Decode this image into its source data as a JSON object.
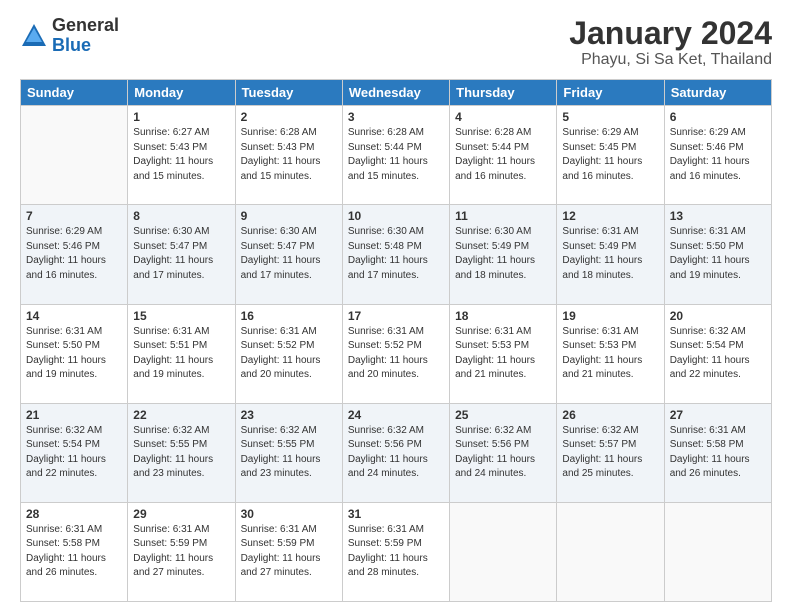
{
  "logo": {
    "general": "General",
    "blue": "Blue"
  },
  "title": "January 2024",
  "subtitle": "Phayu, Si Sa Ket, Thailand",
  "days_of_week": [
    "Sunday",
    "Monday",
    "Tuesday",
    "Wednesday",
    "Thursday",
    "Friday",
    "Saturday"
  ],
  "weeks": [
    [
      {
        "num": "",
        "sunrise": "",
        "sunset": "",
        "daylight": ""
      },
      {
        "num": "1",
        "sunrise": "Sunrise: 6:27 AM",
        "sunset": "Sunset: 5:43 PM",
        "daylight": "Daylight: 11 hours and 15 minutes."
      },
      {
        "num": "2",
        "sunrise": "Sunrise: 6:28 AM",
        "sunset": "Sunset: 5:43 PM",
        "daylight": "Daylight: 11 hours and 15 minutes."
      },
      {
        "num": "3",
        "sunrise": "Sunrise: 6:28 AM",
        "sunset": "Sunset: 5:44 PM",
        "daylight": "Daylight: 11 hours and 15 minutes."
      },
      {
        "num": "4",
        "sunrise": "Sunrise: 6:28 AM",
        "sunset": "Sunset: 5:44 PM",
        "daylight": "Daylight: 11 hours and 16 minutes."
      },
      {
        "num": "5",
        "sunrise": "Sunrise: 6:29 AM",
        "sunset": "Sunset: 5:45 PM",
        "daylight": "Daylight: 11 hours and 16 minutes."
      },
      {
        "num": "6",
        "sunrise": "Sunrise: 6:29 AM",
        "sunset": "Sunset: 5:46 PM",
        "daylight": "Daylight: 11 hours and 16 minutes."
      }
    ],
    [
      {
        "num": "7",
        "sunrise": "Sunrise: 6:29 AM",
        "sunset": "Sunset: 5:46 PM",
        "daylight": "Daylight: 11 hours and 16 minutes."
      },
      {
        "num": "8",
        "sunrise": "Sunrise: 6:30 AM",
        "sunset": "Sunset: 5:47 PM",
        "daylight": "Daylight: 11 hours and 17 minutes."
      },
      {
        "num": "9",
        "sunrise": "Sunrise: 6:30 AM",
        "sunset": "Sunset: 5:47 PM",
        "daylight": "Daylight: 11 hours and 17 minutes."
      },
      {
        "num": "10",
        "sunrise": "Sunrise: 6:30 AM",
        "sunset": "Sunset: 5:48 PM",
        "daylight": "Daylight: 11 hours and 17 minutes."
      },
      {
        "num": "11",
        "sunrise": "Sunrise: 6:30 AM",
        "sunset": "Sunset: 5:49 PM",
        "daylight": "Daylight: 11 hours and 18 minutes."
      },
      {
        "num": "12",
        "sunrise": "Sunrise: 6:31 AM",
        "sunset": "Sunset: 5:49 PM",
        "daylight": "Daylight: 11 hours and 18 minutes."
      },
      {
        "num": "13",
        "sunrise": "Sunrise: 6:31 AM",
        "sunset": "Sunset: 5:50 PM",
        "daylight": "Daylight: 11 hours and 19 minutes."
      }
    ],
    [
      {
        "num": "14",
        "sunrise": "Sunrise: 6:31 AM",
        "sunset": "Sunset: 5:50 PM",
        "daylight": "Daylight: 11 hours and 19 minutes."
      },
      {
        "num": "15",
        "sunrise": "Sunrise: 6:31 AM",
        "sunset": "Sunset: 5:51 PM",
        "daylight": "Daylight: 11 hours and 19 minutes."
      },
      {
        "num": "16",
        "sunrise": "Sunrise: 6:31 AM",
        "sunset": "Sunset: 5:52 PM",
        "daylight": "Daylight: 11 hours and 20 minutes."
      },
      {
        "num": "17",
        "sunrise": "Sunrise: 6:31 AM",
        "sunset": "Sunset: 5:52 PM",
        "daylight": "Daylight: 11 hours and 20 minutes."
      },
      {
        "num": "18",
        "sunrise": "Sunrise: 6:31 AM",
        "sunset": "Sunset: 5:53 PM",
        "daylight": "Daylight: 11 hours and 21 minutes."
      },
      {
        "num": "19",
        "sunrise": "Sunrise: 6:31 AM",
        "sunset": "Sunset: 5:53 PM",
        "daylight": "Daylight: 11 hours and 21 minutes."
      },
      {
        "num": "20",
        "sunrise": "Sunrise: 6:32 AM",
        "sunset": "Sunset: 5:54 PM",
        "daylight": "Daylight: 11 hours and 22 minutes."
      }
    ],
    [
      {
        "num": "21",
        "sunrise": "Sunrise: 6:32 AM",
        "sunset": "Sunset: 5:54 PM",
        "daylight": "Daylight: 11 hours and 22 minutes."
      },
      {
        "num": "22",
        "sunrise": "Sunrise: 6:32 AM",
        "sunset": "Sunset: 5:55 PM",
        "daylight": "Daylight: 11 hours and 23 minutes."
      },
      {
        "num": "23",
        "sunrise": "Sunrise: 6:32 AM",
        "sunset": "Sunset: 5:55 PM",
        "daylight": "Daylight: 11 hours and 23 minutes."
      },
      {
        "num": "24",
        "sunrise": "Sunrise: 6:32 AM",
        "sunset": "Sunset: 5:56 PM",
        "daylight": "Daylight: 11 hours and 24 minutes."
      },
      {
        "num": "25",
        "sunrise": "Sunrise: 6:32 AM",
        "sunset": "Sunset: 5:56 PM",
        "daylight": "Daylight: 11 hours and 24 minutes."
      },
      {
        "num": "26",
        "sunrise": "Sunrise: 6:32 AM",
        "sunset": "Sunset: 5:57 PM",
        "daylight": "Daylight: 11 hours and 25 minutes."
      },
      {
        "num": "27",
        "sunrise": "Sunrise: 6:31 AM",
        "sunset": "Sunset: 5:58 PM",
        "daylight": "Daylight: 11 hours and 26 minutes."
      }
    ],
    [
      {
        "num": "28",
        "sunrise": "Sunrise: 6:31 AM",
        "sunset": "Sunset: 5:58 PM",
        "daylight": "Daylight: 11 hours and 26 minutes."
      },
      {
        "num": "29",
        "sunrise": "Sunrise: 6:31 AM",
        "sunset": "Sunset: 5:59 PM",
        "daylight": "Daylight: 11 hours and 27 minutes."
      },
      {
        "num": "30",
        "sunrise": "Sunrise: 6:31 AM",
        "sunset": "Sunset: 5:59 PM",
        "daylight": "Daylight: 11 hours and 27 minutes."
      },
      {
        "num": "31",
        "sunrise": "Sunrise: 6:31 AM",
        "sunset": "Sunset: 5:59 PM",
        "daylight": "Daylight: 11 hours and 28 minutes."
      },
      {
        "num": "",
        "sunrise": "",
        "sunset": "",
        "daylight": ""
      },
      {
        "num": "",
        "sunrise": "",
        "sunset": "",
        "daylight": ""
      },
      {
        "num": "",
        "sunrise": "",
        "sunset": "",
        "daylight": ""
      }
    ]
  ]
}
